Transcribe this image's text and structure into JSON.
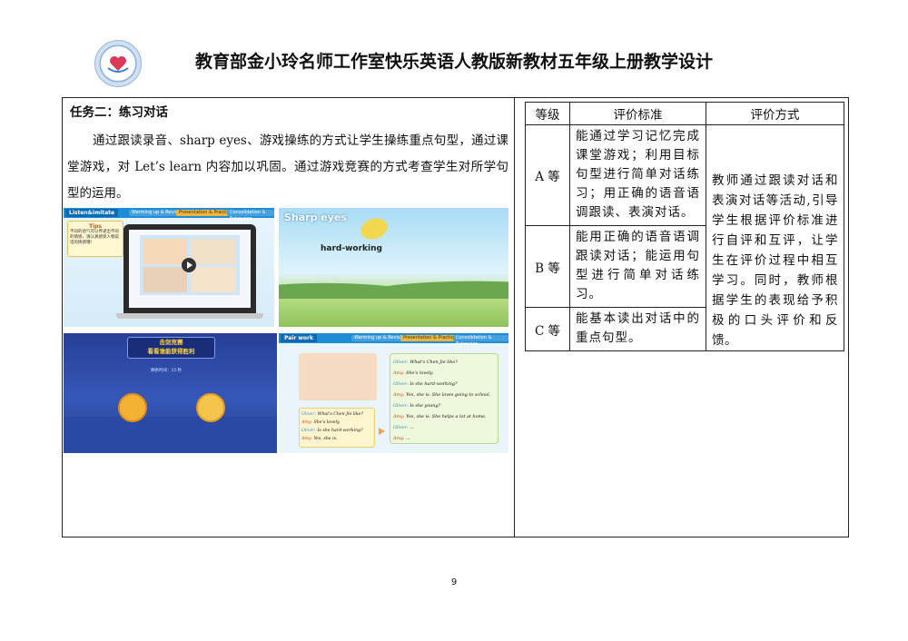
{
  "header": {
    "title": "教育部金小玲名师工作室快乐英语人教版新教材五年级上册教学设计"
  },
  "task": {
    "title": "任务二：练习对话",
    "description": "通过跟读录音、sharp eyes、游戏操练的方式让学生操练重点句型，通过课堂游戏，对 Let’s learn 内容加以巩固。通过游戏竞赛的方式考查学生对所学句型的运用。"
  },
  "slides": {
    "slide1": {
      "label": "Listen&imitate",
      "tips_title": "Tips",
      "tips_text": "不同的语气可以传递出不同的情感，请认真感受人物说话的情感哦！",
      "nav": [
        "Warming up & Revision",
        "Presentation & Practice",
        "Consolidation & Extension"
      ]
    },
    "slide2": {
      "label": "Sharp eyes",
      "word": "hard-working"
    },
    "slide3": {
      "line1": "击剑竞赛",
      "line2": "看看谁能获得胜利",
      "timer": "剩余时间：15 秒"
    },
    "slide4": {
      "label": "Pair work",
      "nav": [
        "Warming up & Revision",
        "Presentation & Practice",
        "Consolidation & Extension"
      ],
      "dialog_left": [
        {
          "speaker": "Oliver:",
          "line": "What's Chen Jie like?"
        },
        {
          "speaker": "Amy:",
          "line": "She's lovely."
        },
        {
          "speaker": "Oliver:",
          "line": "Is she hard-working?"
        },
        {
          "speaker": "Amy:",
          "line": "Yes, she is."
        }
      ],
      "dialog_right": [
        {
          "speaker": "Oliver:",
          "line": "What's Chen Jie like?"
        },
        {
          "speaker": "Amy:",
          "line": "She's lovely."
        },
        {
          "speaker": "Oliver:",
          "line": "Is she hard-working?"
        },
        {
          "speaker": "Amy:",
          "line": "Yes, she is. She loves going to school."
        },
        {
          "speaker": "Oliver:",
          "line": "Is she young?"
        },
        {
          "speaker": "Amy:",
          "line": "Yes, she is. She helps a lot at home."
        },
        {
          "speaker": "Oliver:",
          "line": "..."
        },
        {
          "speaker": "Amy:",
          "line": "..."
        }
      ]
    }
  },
  "evaluation": {
    "headers": [
      "等级",
      "评价标准",
      "评价方式"
    ],
    "rows": [
      {
        "grade": "A 等",
        "criteria": "能通过学习记忆完成课堂游戏；利用目标句型进行简单对话练习；用正确的语音语调跟读、表演对话。"
      },
      {
        "grade": "B 等",
        "criteria": "能用正确的语音语调跟读对话；能运用句型进行简单对话练习。"
      },
      {
        "grade": "C 等",
        "criteria": "能基本读出对话中的重点句型。"
      }
    ],
    "method": "教师通过跟读对话和表演对话等活动,引导学生根据评价标准进行自评和互评，让学生在评价过程中相互学习。同时，教师根据学生的表现给予积极的口头评价和反馈。"
  },
  "footer": {
    "page_number": "9"
  }
}
